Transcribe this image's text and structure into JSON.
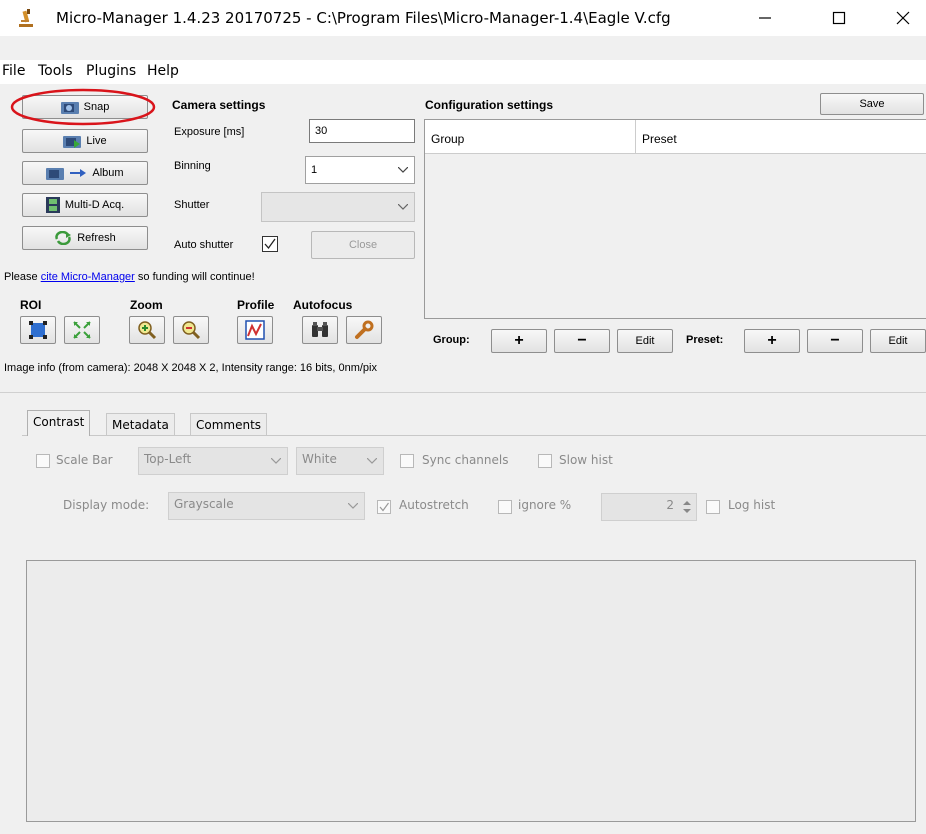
{
  "window": {
    "title": "Micro-Manager 1.4.23 20170725 - C:\\Program Files\\Micro-Manager-1.4\\Eagle V.cfg",
    "minimize": "—",
    "maximize": "☐",
    "close": "✕"
  },
  "menu": [
    "File",
    "Tools",
    "Plugins",
    "Help"
  ],
  "left_buttons": {
    "snap": "Snap",
    "live": "Live",
    "album": "Album",
    "multid": "Multi-D Acq.",
    "refresh": "Refresh"
  },
  "camera": {
    "heading": "Camera settings",
    "exposure_label": "Exposure [ms]",
    "exposure_value": "30",
    "binning_label": "Binning",
    "binning_value": "1",
    "shutter_label": "Shutter",
    "shutter_value": "",
    "auto_shutter_label": "Auto shutter",
    "auto_shutter_checked": true,
    "close_label": "Close"
  },
  "config": {
    "heading": "Configuration settings",
    "save_label": "Save",
    "col_group": "Group",
    "col_preset": "Preset",
    "group_label": "Group:",
    "preset_label": "Preset:",
    "plus": "+",
    "minus": "−",
    "edit": "Edit"
  },
  "cite": {
    "prefix": "Please ",
    "link": "cite Micro-Manager",
    "suffix": " so funding will continue!"
  },
  "tool_groups": {
    "roi": "ROI",
    "zoom": "Zoom",
    "profile": "Profile",
    "autofocus": "Autofocus"
  },
  "image_info": "Image info (from camera): 2048 X 2048 X 2, Intensity range: 16 bits, 0nm/pix",
  "tabs": [
    "Contrast",
    "Metadata",
    "Comments"
  ],
  "contrast": {
    "scale_bar_label": "Scale Bar",
    "position_value": "Top-Left",
    "color_value": "White",
    "sync_label": "Sync channels",
    "slow_hist_label": "Slow hist",
    "display_mode_label": "Display mode:",
    "display_mode_value": "Grayscale",
    "autostretch_label": "Autostretch",
    "ignore_label": "ignore %",
    "ignore_value": "2",
    "log_hist_label": "Log hist"
  },
  "colors": {
    "highlight_ring": "#d9141b",
    "link": "#0000ee"
  }
}
